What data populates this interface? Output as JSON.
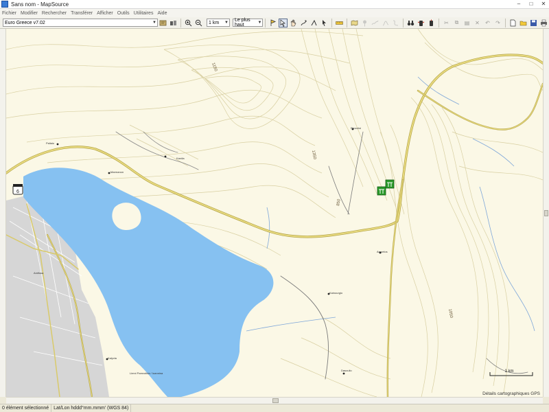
{
  "window": {
    "title": "Sans nom - MapSource",
    "controls": [
      "–",
      "□",
      "✕"
    ]
  },
  "menu": [
    "Fichier",
    "Modifier",
    "Rechercher",
    "Transférer",
    "Afficher",
    "Outils",
    "Utilitaires",
    "Aide"
  ],
  "toolbar": {
    "map_product": "Euro Greece v7.02",
    "zoom_scale": "1 km",
    "detail_level": "Le plus haut"
  },
  "map": {
    "route_shield": "6",
    "contour_labels": [
      "1150",
      "1350",
      "850",
      "1050"
    ],
    "place_labels": [
      "Rizovrisi",
      "Amfissa",
      "Paliaio",
      "Marmanon",
      "Kardia",
      "Ampelos",
      "Kainourgio",
      "Kalyvia",
      "Limni Pamvotida / Ioannina",
      "Dasoulio"
    ],
    "scale_bar_label": "1 km",
    "attribution": "Détails cartographiques GPS",
    "colors": {
      "land": "#fbf8e6",
      "water": "#86c1f1",
      "contour": "#d8cfa1",
      "road": "#d9ca6a",
      "road_edge": "#b3a447",
      "urban": "#d6d6d6"
    }
  },
  "status": {
    "selection": "0 élément sélectionné",
    "coord_format": "Lat/Lon hddd°mm.mmm' (WGS 84)"
  }
}
